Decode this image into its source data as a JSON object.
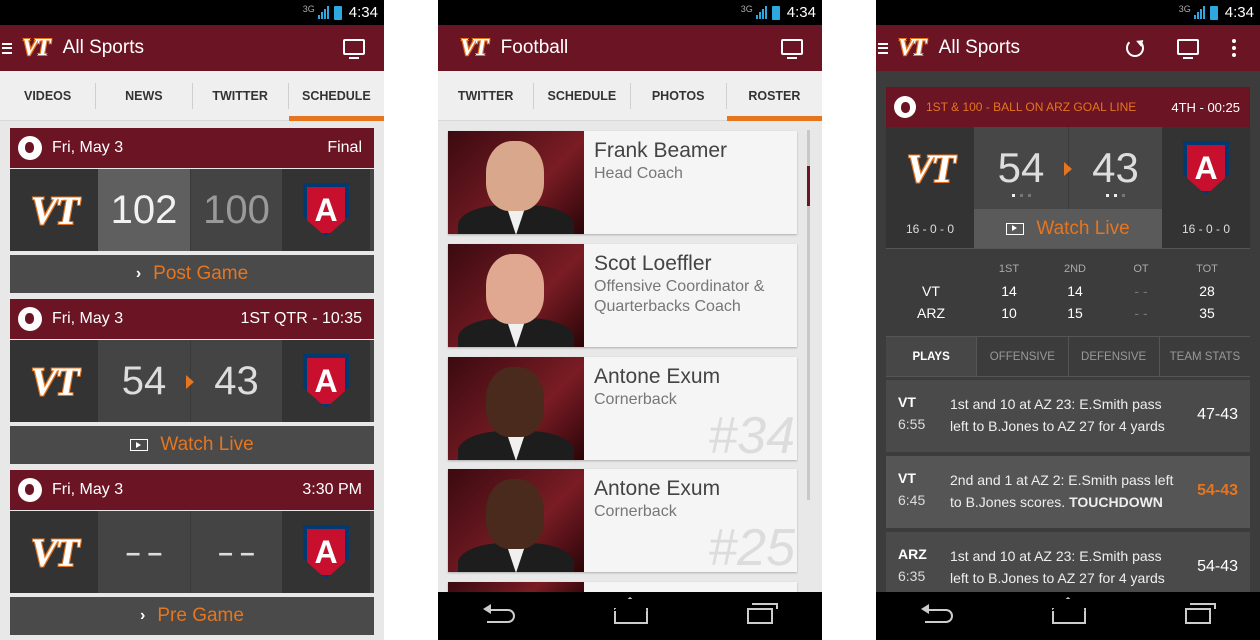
{
  "colors": {
    "maroon": "#6b1424",
    "orange": "#e5751f",
    "dark": "#333333"
  },
  "status": {
    "network": "3G",
    "time": "4:34"
  },
  "screen1": {
    "title": "All Sports",
    "tabs": [
      "VIDEOS",
      "NEWS",
      "TWITTER",
      "SCHEDULE"
    ],
    "active_tab": "SCHEDULE",
    "games": [
      {
        "date": "Fri, May 3",
        "status": "Final",
        "home": "VT",
        "away": "A",
        "home_score": "102",
        "away_score": "100",
        "action": "Post Game"
      },
      {
        "date": "Fri, May 3",
        "status": "1ST QTR - 10:35",
        "home": "VT",
        "away": "A",
        "home_score": "54",
        "away_score": "43",
        "action": "Watch Live"
      },
      {
        "date": "Fri, May 3",
        "status": "3:30 PM",
        "home": "VT",
        "away": "A",
        "home_score": "– –",
        "away_score": "– –",
        "action": "Pre Game"
      }
    ]
  },
  "screen2": {
    "title": "Football",
    "tabs": [
      "TWITTER",
      "SCHEDULE",
      "PHOTOS",
      "ROSTER"
    ],
    "active_tab": "ROSTER",
    "roster": [
      {
        "name": "Frank Beamer",
        "role": "Head Coach",
        "number": ""
      },
      {
        "name": "Scot Loeffler",
        "role": "Offensive Coordinator & Quarterbacks Coach",
        "number": ""
      },
      {
        "name": "Antone Exum",
        "role": "Cornerback",
        "number": "#34"
      },
      {
        "name": "Antone Exum",
        "role": "Cornerback",
        "number": "#25"
      }
    ]
  },
  "screen3": {
    "title": "All Sports",
    "situation": "1ST & 100 - BALL ON ARZ GOAL LINE",
    "clock": "4TH - 00:25",
    "home": "VT",
    "away": "A",
    "home_score": "54",
    "away_score": "43",
    "home_record": "16 - 0 - 0",
    "away_record": "16 - 0 - 0",
    "watch_label": "Watch Live",
    "linescore": {
      "headers": [
        "1ST",
        "2ND",
        "OT",
        "TOT"
      ],
      "rows": [
        {
          "team": "VT",
          "cells": [
            "14",
            "14",
            "- -",
            "28"
          ]
        },
        {
          "team": "ARZ",
          "cells": [
            "10",
            "15",
            "- -",
            "35"
          ]
        }
      ]
    },
    "tabs": [
      "PLAYS",
      "OFFENSIVE",
      "DEFENSIVE",
      "TEAM STATS"
    ],
    "plays": [
      {
        "team": "VT",
        "time": "6:55",
        "desc": "1st and 10 at AZ 23: E.Smith pass left to B.Jones to AZ 27 for 4 yards",
        "highlight": "",
        "score": "47-43"
      },
      {
        "team": "VT",
        "time": "6:45",
        "desc": "2nd and 1 at AZ 2: E.Smith pass left to B.Jones scores.",
        "highlight": "TOUCHDOWN",
        "score": "54-43"
      },
      {
        "team": "ARZ",
        "time": "6:35",
        "desc": "1st and 10 at AZ 23: E.Smith pass left to B.Jones to AZ 27 for 4 yards",
        "highlight": "",
        "score": "54-43"
      }
    ]
  }
}
